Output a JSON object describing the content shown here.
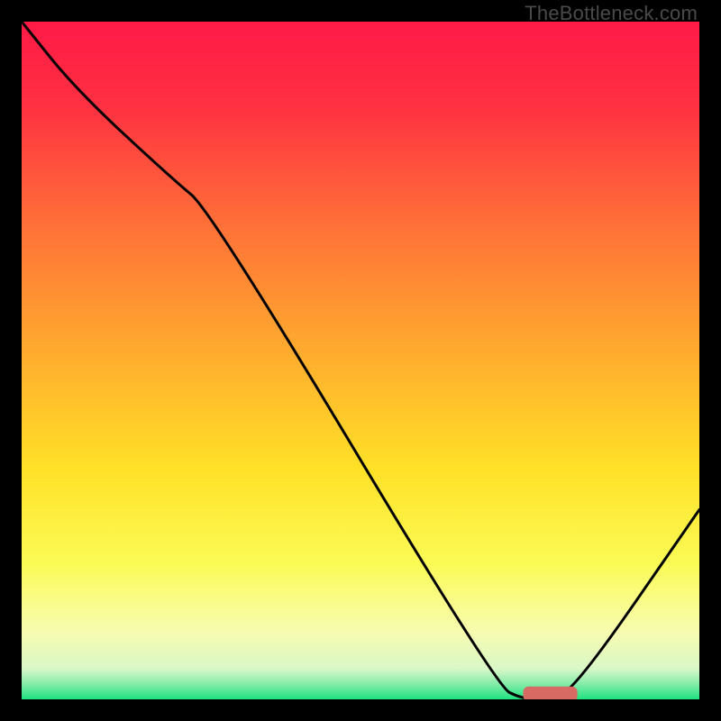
{
  "watermark": "TheBottleneck.com",
  "chart_data": {
    "type": "line",
    "title": "",
    "xlabel": "",
    "ylabel": "",
    "xlim": [
      0,
      100
    ],
    "ylim": [
      0,
      100
    ],
    "grid": false,
    "legend": false,
    "gradient_stops": [
      {
        "offset": 0.0,
        "color": "#ff1a46"
      },
      {
        "offset": 0.12,
        "color": "#ff2f42"
      },
      {
        "offset": 0.3,
        "color": "#ff7038"
      },
      {
        "offset": 0.48,
        "color": "#ffa92e"
      },
      {
        "offset": 0.66,
        "color": "#ffe127"
      },
      {
        "offset": 0.8,
        "color": "#fbfb56"
      },
      {
        "offset": 0.9,
        "color": "#f7fcb0"
      },
      {
        "offset": 0.955,
        "color": "#d9f7c7"
      },
      {
        "offset": 0.975,
        "color": "#8eedad"
      },
      {
        "offset": 1.0,
        "color": "#1ee27f"
      }
    ],
    "series": [
      {
        "name": "bottleneck-curve",
        "x": [
          0,
          8,
          22,
          28,
          70,
          74,
          78,
          82,
          100
        ],
        "y": [
          100,
          90,
          77,
          72,
          2,
          0,
          0,
          2,
          28
        ]
      }
    ],
    "marker": {
      "name": "optimal-range",
      "x_start": 74,
      "x_end": 82,
      "y": 0.8,
      "color": "#d86a64",
      "thickness": 2.2
    }
  }
}
